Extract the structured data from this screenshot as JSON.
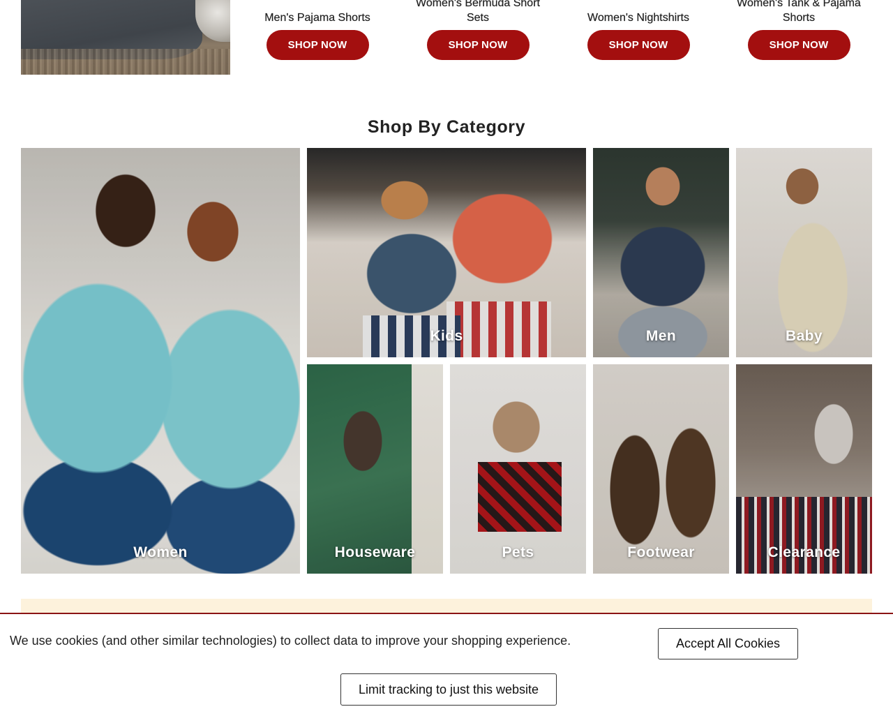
{
  "promo_row": {
    "image_alt": "Dog lying on a blanket",
    "items": [
      {
        "title": "Men's Pajama Shorts",
        "button": "SHOP NOW"
      },
      {
        "title": "Women's Bermuda Short Sets",
        "button": "SHOP NOW"
      },
      {
        "title": "Women's Nightshirts",
        "button": "SHOP NOW"
      },
      {
        "title": "Women's Tank & Pajama Shorts",
        "button": "SHOP NOW"
      }
    ]
  },
  "category_section": {
    "title": "Shop By Category",
    "tiles": [
      {
        "label": "Women"
      },
      {
        "label": "Kids"
      },
      {
        "label": "Men"
      },
      {
        "label": "Baby"
      },
      {
        "label": "Houseware"
      },
      {
        "label": "Pets"
      },
      {
        "label": "Footwear"
      },
      {
        "label": "Clearance"
      }
    ]
  },
  "cookie_banner": {
    "message": "We use cookies (and other similar technologies) to collect data to improve your shopping experience.",
    "accept_label": "Accept All Cookies",
    "limit_label": "Limit tracking to just this website"
  },
  "colors": {
    "brand_red": "#a30f0f",
    "banner_border": "#8a1414",
    "promo_strip": "#fdf2dc"
  }
}
